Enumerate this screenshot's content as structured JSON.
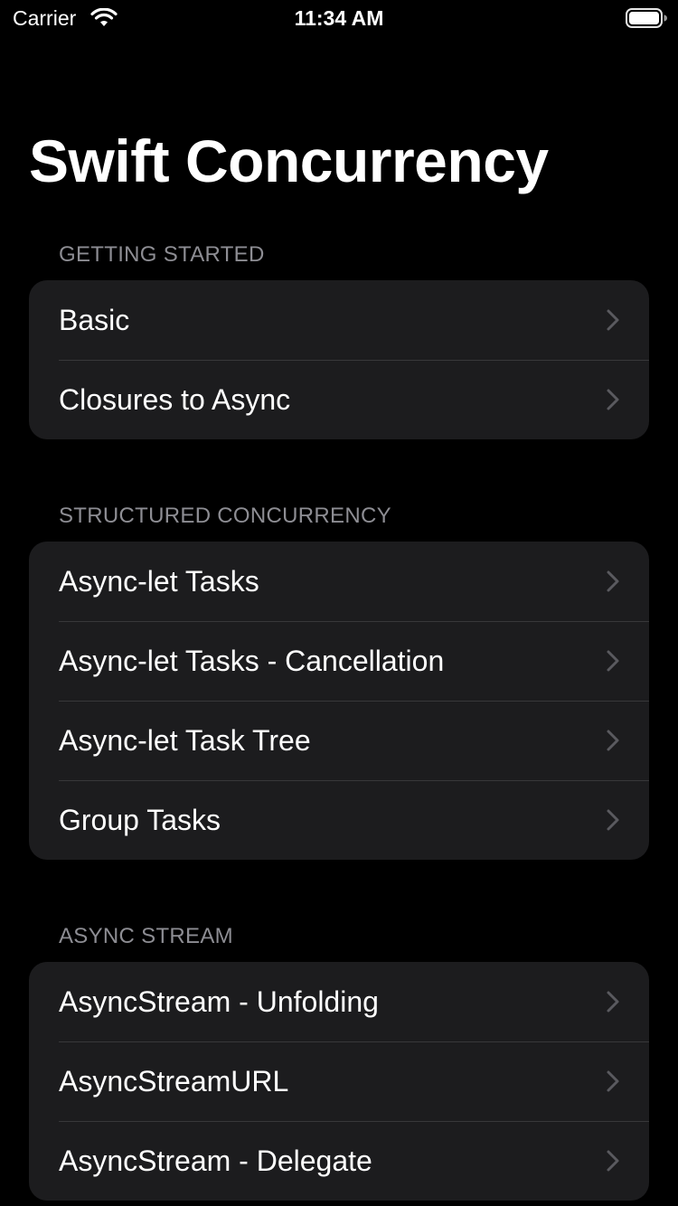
{
  "status_bar": {
    "carrier": "Carrier",
    "time": "11:34 AM"
  },
  "title": "Swift Concurrency",
  "sections": [
    {
      "header": "GETTING STARTED",
      "items": [
        {
          "label": "Basic"
        },
        {
          "label": "Closures to Async"
        }
      ]
    },
    {
      "header": "STRUCTURED CONCURRENCY",
      "items": [
        {
          "label": "Async-let Tasks"
        },
        {
          "label": "Async-let Tasks - Cancellation"
        },
        {
          "label": "Async-let Task Tree"
        },
        {
          "label": "Group Tasks"
        }
      ]
    },
    {
      "header": "ASYNC STREAM",
      "items": [
        {
          "label": "AsyncStream - Unfolding"
        },
        {
          "label": "AsyncStreamURL"
        },
        {
          "label": "AsyncStream - Delegate"
        }
      ]
    }
  ],
  "icons": {
    "wifi": "wifi-icon",
    "battery": "battery-icon",
    "chevron": "chevron-right-icon"
  },
  "colors": {
    "background": "#000000",
    "cell_background": "#1c1c1e",
    "separator": "#38383a",
    "section_header": "#8d8d93",
    "chevron": "#5a5a5f"
  }
}
